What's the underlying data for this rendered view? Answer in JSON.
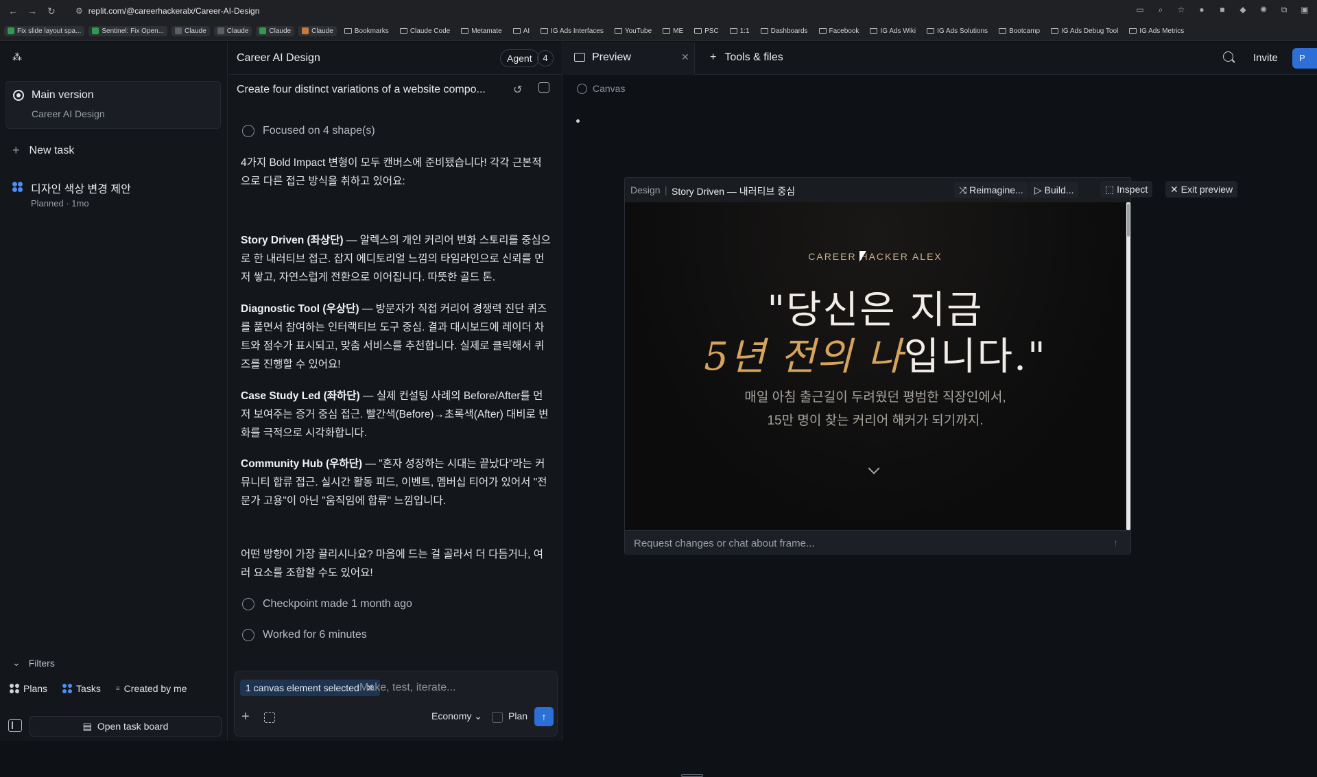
{
  "browser": {
    "url": "replit.com/@careerhackeralx/Career-AI-Design",
    "bookmarks": [
      {
        "label": "Fix slide layout spa...",
        "type": "tag",
        "color": "#2e9c4a"
      },
      {
        "label": "Sentinel: Fix Open...",
        "type": "tag",
        "color": "#2e9c4a"
      },
      {
        "label": "Claude",
        "type": "tag",
        "color": ""
      },
      {
        "label": "Claude",
        "type": "tag",
        "color": ""
      },
      {
        "label": "Claude",
        "type": "tag",
        "color": "#2e9c4a"
      },
      {
        "label": "Claude",
        "type": "tag",
        "color": "#c97a3a"
      },
      {
        "label": "Bookmarks",
        "type": "folder"
      },
      {
        "label": "Claude Code",
        "type": "folder"
      },
      {
        "label": "Metamate",
        "type": "folder"
      },
      {
        "label": "AI",
        "type": "folder"
      },
      {
        "label": "IG Ads Interfaces",
        "type": "folder"
      },
      {
        "label": "YouTube",
        "type": "folder"
      },
      {
        "label": "ME",
        "type": "folder"
      },
      {
        "label": "PSC",
        "type": "folder"
      },
      {
        "label": "1:1",
        "type": "folder"
      },
      {
        "label": "Dashboards",
        "type": "folder"
      },
      {
        "label": "Facebook",
        "type": "folder"
      },
      {
        "label": "IG Ads Wiki",
        "type": "folder"
      },
      {
        "label": "IG Ads Solutions",
        "type": "folder"
      },
      {
        "label": "Bootcamp",
        "type": "folder"
      },
      {
        "label": "IG Ads Debug Tool",
        "type": "folder"
      },
      {
        "label": "IG Ads Metrics",
        "type": "folder"
      }
    ]
  },
  "sidebar": {
    "main_version": {
      "title": "Main version",
      "subtitle": "Career AI Design"
    },
    "new_task": "New task",
    "task": {
      "title": "디자인 색상 변경 제안",
      "subtitle": "Planned · 1mo"
    },
    "filters": "Filters",
    "filter_items": {
      "plans": "Plans",
      "tasks": "Tasks",
      "created_by_me": "Created by me"
    },
    "open_task_board": "Open task board"
  },
  "chat": {
    "title": "Career AI Design",
    "agent_label": "Agent",
    "agent_count": "4",
    "task_line": "Create four distinct variations of a website compo...",
    "focused": "Focused on 4 shape(s)",
    "intro": "4가지 Bold Impact 변형이 모두 캔버스에 준비됐습니다! 각각 근본적으로 다른 접근 방식을 취하고 있어요:",
    "variants": [
      {
        "name": "Story Driven (좌상단)",
        "desc": " — 알렉스의 개인 커리어 변화 스토리를 중심으로 한 내러티브 접근. 잡지 에디토리얼 느낌의 타임라인으로 신뢰를 먼저 쌓고, 자연스럽게 전환으로 이어집니다. 따뜻한 골드 톤."
      },
      {
        "name": "Diagnostic Tool (우상단)",
        "desc": " — 방문자가 직접 커리어 경쟁력 진단 퀴즈를 풀면서 참여하는 인터랙티브 도구 중심. 결과 대시보드에 레이더 차트와 점수가 표시되고, 맞춤 서비스를 추천합니다. 실제로 클릭해서 퀴즈를 진행할 수 있어요!"
      },
      {
        "name": "Case Study Led (좌하단)",
        "desc": " — 실제 컨설팅 사례의 Before/After를 먼저 보여주는 증거 중심 접근. 빨간색(Before)→초록색(After) 대비로 변화를 극적으로 시각화합니다."
      },
      {
        "name": "Community Hub (우하단)",
        "desc": " — \"혼자 성장하는 시대는 끝났다\"라는 커뮤니티 합류 접근. 실시간 활동 피드, 이벤트, 멤버십 티어가 있어서 \"전문가 고용\"이 아닌 \"움직임에 합류\" 느낌입니다."
      }
    ],
    "closing": "어떤 방향이 가장 끌리시나요? 마음에 드는 걸 골라서 더 다듬거나, 여러 요소를 조합할 수도 있어요!",
    "checkpoint": "Checkpoint made 1 month ago",
    "worked": "Worked for 6 minutes",
    "composer": {
      "chip": "1 canvas element selected",
      "placeholder": "Make, test, iterate...",
      "mode": "Economy",
      "plan": "Plan"
    }
  },
  "right": {
    "tab_preview": "Preview",
    "tab_tools": "Tools & files",
    "invite": "Invite",
    "canvas_label": "Canvas",
    "frame": {
      "design_label": "Design",
      "name": "Story Driven — 내러티브 중심",
      "buttons": {
        "reimagine": "Reimagine...",
        "build": "Build...",
        "inspect": "Inspect",
        "exit": "Exit preview"
      },
      "hero": {
        "tag": "CAREER HACKER ALEX",
        "line1": "\"당신은 지금",
        "line2_gold": "5년 전의 나",
        "line2_rest": "입니다.\"",
        "sub1": "매일 아침 출근길이 두려웠던 평범한 직장인에서,",
        "sub2": "15만 명이 찾는 커리어 해커가 되기까지."
      },
      "input_placeholder": "Request changes or chat about frame..."
    }
  }
}
